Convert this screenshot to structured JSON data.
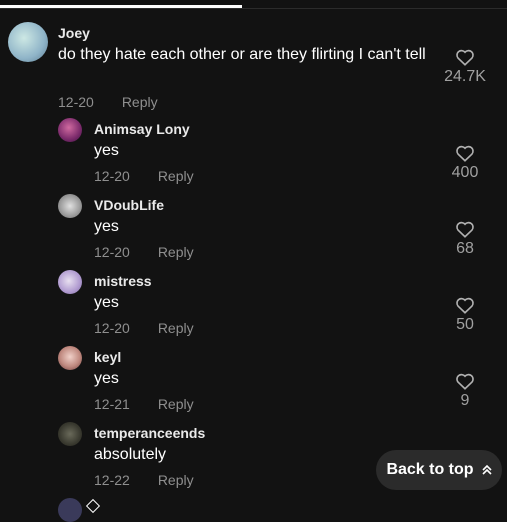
{
  "comments": [
    {
      "user": "Joey",
      "text": "do they hate each other or are they flirting I can't tell",
      "date": "12-20",
      "reply": "Reply",
      "likes": "24.7K"
    },
    {
      "user": "Animsay Lony",
      "text": "yes",
      "date": "12-20",
      "reply": "Reply",
      "likes": "400"
    },
    {
      "user": "VDoubLife",
      "text": "yes",
      "date": "12-20",
      "reply": "Reply",
      "likes": "68"
    },
    {
      "user": "mistress",
      "text": "yes",
      "date": "12-20",
      "reply": "Reply",
      "likes": "50"
    },
    {
      "user": "keyl",
      "text": "yes",
      "date": "12-21",
      "reply": "Reply",
      "likes": "9"
    },
    {
      "user": "temperanceends",
      "text": "absolutely",
      "date": "12-22",
      "reply": "Reply",
      "likes": ""
    }
  ],
  "back_to_top": {
    "label": "Back to top",
    "icon": "double-chevron-up-icon"
  },
  "colors": {
    "background": "#121212",
    "muted": "#8f8f8f",
    "button_bg": "#2b2b2b"
  }
}
